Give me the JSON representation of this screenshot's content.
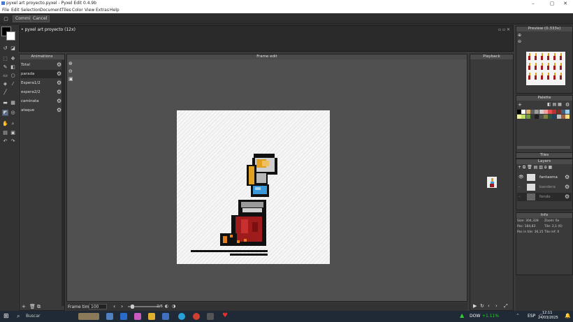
{
  "window": {
    "title": "pyxel art proyecto.pyxel - Pyxel Edit 0.4.9b"
  },
  "menu": [
    "File",
    "Edit",
    "Selection",
    "Document",
    "Tiles",
    "Color",
    "View",
    "Extras",
    "Help"
  ],
  "toolbar": {
    "commit": "Commit",
    "cancel": "Cancel"
  },
  "document": {
    "tab": "• pyxel art proyecto  (12x)"
  },
  "animations": {
    "title": "Animations",
    "items": [
      "Total",
      "parada",
      "Espera1/2",
      "espera2/2",
      "caminata",
      "ataque"
    ],
    "selected_index": 1
  },
  "frame_edit": {
    "title": "Frame edit"
  },
  "frame_time": {
    "label": "Frame time",
    "value": "100",
    "counter": "2/6"
  },
  "playback": {
    "title": "Playback"
  },
  "preview": {
    "title": "Preview (0.333x)"
  },
  "palette": {
    "title": "Palette",
    "colors": [
      "#000000",
      "#ffffff",
      "#e0b070",
      "#606060",
      "#9a9a9a",
      "#d0d0d0",
      "#f0a0a0",
      "#e05050",
      "#c03030",
      "#803020",
      "#406080",
      "#a0d0f0",
      "#f0f0a0",
      "#c0e060",
      "#70a040",
      "#3a3a3a",
      "#202020",
      "#505050",
      "#808040",
      "#305030",
      "#204060",
      "#c0c0c0",
      "#a06040",
      "#ffe080"
    ]
  },
  "tiles": {
    "title": "Tiles"
  },
  "layers": {
    "title": "Layers",
    "items": [
      "fantasma",
      "bandera",
      "fondo"
    ]
  },
  "info": {
    "title": "Info",
    "size": "Size: 304,328",
    "zoom": "Zoom: 6x",
    "pos": "Pos: 184,83",
    "tile": "Tile: 2,1 (6)",
    "pos_in_tile": "Pos in tile: 36,15",
    "tile_ref": "Tile ref: X"
  },
  "taskbar": {
    "search": "Buscar",
    "stock": "DOW",
    "stock_change": "+1.11%",
    "lang": "ESP",
    "time": "12:11",
    "date": "24/03/2025"
  },
  "colors": {
    "accent": "#4a7bd0",
    "primary_swatch": "#000000",
    "secondary_swatch": "#ffffff"
  }
}
